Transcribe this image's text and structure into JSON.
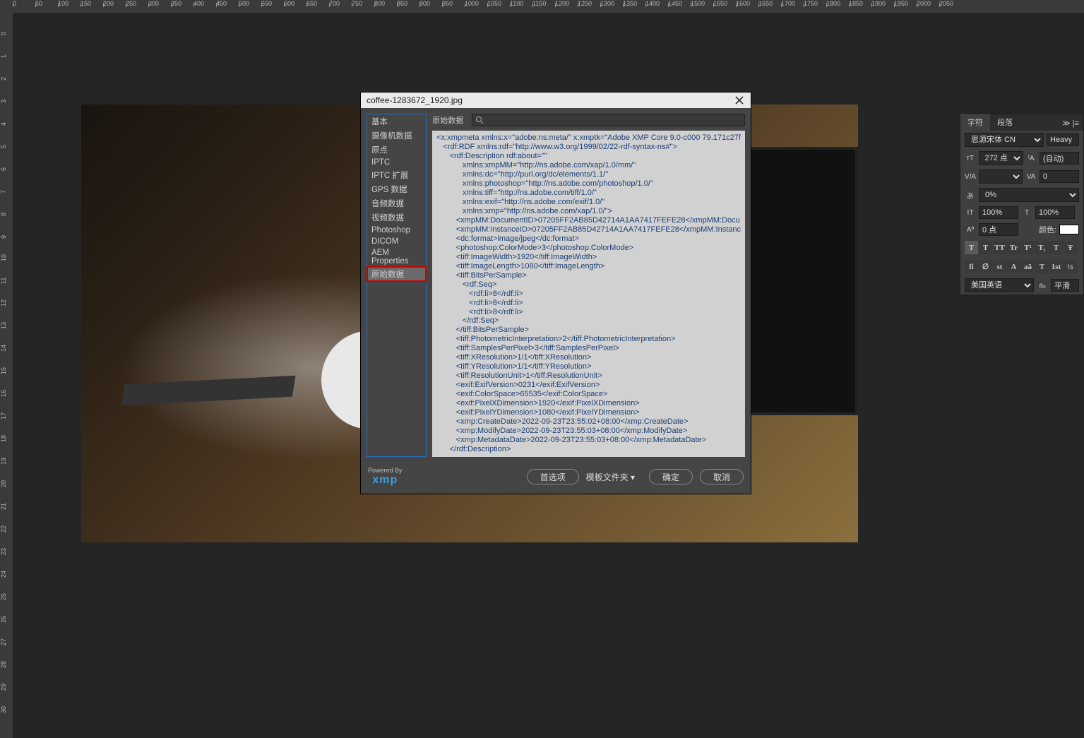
{
  "ruler": {
    "marks": [
      0,
      50,
      100,
      150,
      200,
      250,
      300,
      350,
      400,
      450,
      500,
      550,
      600,
      650,
      700,
      750,
      800,
      850,
      900,
      950,
      1000,
      1050,
      1100,
      1150,
      1200,
      1250,
      1300,
      1350,
      1400,
      1450,
      1500,
      1550,
      1600,
      1650,
      1700,
      1750,
      1800,
      1850,
      1900,
      1950,
      2000,
      2050
    ]
  },
  "dialog": {
    "title": "coffee-1283672_1920.jpg",
    "categories": [
      "基本",
      "摄像机数据",
      "原点",
      "IPTC",
      "IPTC 扩展",
      "GPS 数据",
      "音频数据",
      "视频数据",
      "Photoshop",
      "DICOM",
      "AEM Properties",
      "原始数据"
    ],
    "selected_category": "原始数据",
    "raw_label": "原始数据",
    "search_placeholder": "",
    "xml": "<x:xmpmeta xmlns:x=\"adobe:ns:meta/\" x:xmptk=\"Adobe XMP Core 9.0-c000 79.171c27f\n   <rdf:RDF xmlns:rdf=\"http://www.w3.org/1999/02/22-rdf-syntax-ns#\">\n      <rdf:Description rdf:about=\"\"\n            xmlns:xmpMM=\"http://ns.adobe.com/xap/1.0/mm/\"\n            xmlns:dc=\"http://purl.org/dc/elements/1.1/\"\n            xmlns:photoshop=\"http://ns.adobe.com/photoshop/1.0/\"\n            xmlns:tiff=\"http://ns.adobe.com/tiff/1.0/\"\n            xmlns:exif=\"http://ns.adobe.com/exif/1.0/\"\n            xmlns:xmp=\"http://ns.adobe.com/xap/1.0/\">\n         <xmpMM:DocumentID>07205FF2AB85D42714A1AA7417FEFE28</xmpMM:Docu\n         <xmpMM:InstanceID>07205FF2AB85D42714A1AA7417FEFE28</xmpMM:Instanc\n         <dc:format>image/jpeg</dc:format>\n         <photoshop:ColorMode>3</photoshop:ColorMode>\n         <tiff:ImageWidth>1920</tiff:ImageWidth>\n         <tiff:ImageLength>1080</tiff:ImageLength>\n         <tiff:BitsPerSample>\n            <rdf:Seq>\n               <rdf:li>8</rdf:li>\n               <rdf:li>8</rdf:li>\n               <rdf:li>8</rdf:li>\n            </rdf:Seq>\n         </tiff:BitsPerSample>\n         <tiff:PhotometricInterpretation>2</tiff:PhotometricInterpretation>\n         <tiff:SamplesPerPixel>3</tiff:SamplesPerPixel>\n         <tiff:XResolution>1/1</tiff:XResolution>\n         <tiff:YResolution>1/1</tiff:YResolution>\n         <tiff:ResolutionUnit>1</tiff:ResolutionUnit>\n         <exif:ExifVersion>0231</exif:ExifVersion>\n         <exif:ColorSpace>65535</exif:ColorSpace>\n         <exif:PixelXDimension>1920</exif:PixelXDimension>\n         <exif:PixelYDimension>1080</exif:PixelYDimension>\n         <xmp:CreateDate>2022-09-23T23:55:02+08:00</xmp:CreateDate>\n         <xmp:ModifyDate>2022-09-23T23:55:03+08:00</xmp:ModifyDate>\n         <xmp:MetadataDate>2022-09-23T23:55:03+08:00</xmp:MetadataDate>\n      </rdf:Description>",
    "powered_by": "Powered By",
    "logo": "xmp",
    "buttons": {
      "prefs": "首选项",
      "templates": "模板文件夹 ▾",
      "ok": "确定",
      "cancel": "取消"
    }
  },
  "char_panel": {
    "tabs": {
      "char": "字符",
      "para": "段落"
    },
    "font_family": "思源宋体 CN",
    "font_style": "Heavy",
    "font_size": "272 点",
    "leading": "(自动)",
    "kerning": "",
    "tracking": "0",
    "scale": "0%",
    "vscale": "100%",
    "hscale": "100%",
    "baseline": "0 点",
    "color_label": "颜色:",
    "language": "美国英语",
    "aa": "平滑",
    "style_buttons": [
      "T",
      "T",
      "TT",
      "Tr",
      "T¹",
      "T₁",
      "T",
      "Ŧ"
    ],
    "ot_buttons": [
      "fi",
      "∅",
      "st",
      "A",
      "aā",
      "T",
      "1st",
      "½"
    ]
  }
}
